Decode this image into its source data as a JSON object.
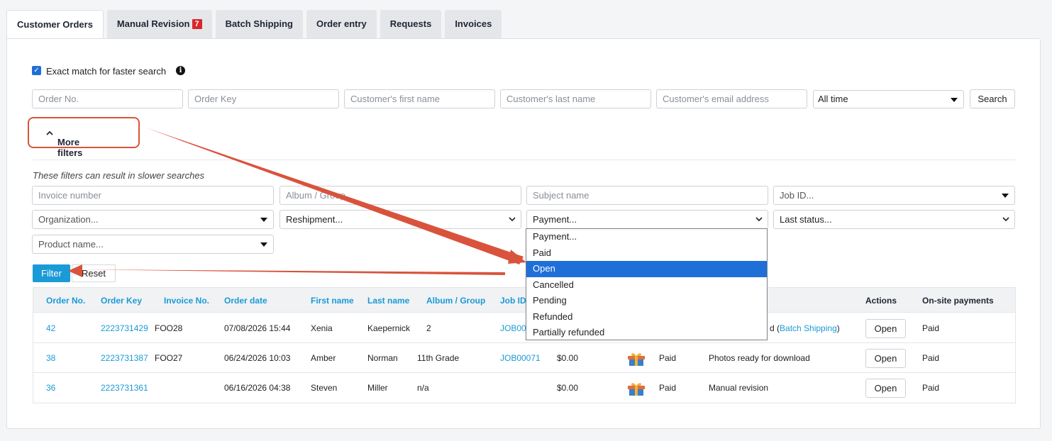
{
  "tabs": [
    {
      "label": "Customer Orders",
      "active": true
    },
    {
      "label": "Manual Revision",
      "badge": "7"
    },
    {
      "label": "Batch Shipping"
    },
    {
      "label": "Order entry"
    },
    {
      "label": "Requests"
    },
    {
      "label": "Invoices"
    }
  ],
  "search": {
    "exact_match_label": "Exact match for faster search",
    "exact_match_checked": true,
    "order_no_placeholder": "Order No.",
    "order_key_placeholder": "Order Key",
    "first_name_placeholder": "Customer's first name",
    "last_name_placeholder": "Customer's last name",
    "email_placeholder": "Customer's email address",
    "time_range_value": "All time",
    "search_label": "Search"
  },
  "more_filters": {
    "toggle_label": "More filters",
    "toggle_icon": "^",
    "note": "These filters can result in slower searches",
    "invoice_placeholder": "Invoice number",
    "album_placeholder": "Album / Group",
    "subject_placeholder": "Subject name",
    "job_placeholder": "Job ID...",
    "organization_placeholder": "Organization...",
    "reshipment_placeholder": "Reshipment...",
    "payment_placeholder": "Payment...",
    "last_status_placeholder": "Last status...",
    "product_placeholder": "Product name...",
    "filter_label": "Filter",
    "reset_label": "Reset"
  },
  "payment_dropdown": {
    "options": [
      "Payment...",
      "Paid",
      "Open",
      "Cancelled",
      "Pending",
      "Refunded",
      "Partially refunded"
    ],
    "highlighted": "Open"
  },
  "table": {
    "headers": {
      "order_no": "Order No.",
      "order_key": "Order Key",
      "invoice_no": "Invoice No.",
      "order_date": "Order date",
      "first_name": "First name",
      "last_name": "Last name",
      "album": "Album / Group",
      "job_id": "Job ID",
      "actions": "Actions",
      "onsite": "On-site payments"
    },
    "rows": [
      {
        "order_no": "42",
        "order_key": "2223731429",
        "invoice_no": "FOO28",
        "order_date": "07/08/2026 15:44",
        "first_name": "Xenia",
        "last_name": "Kaepernick",
        "album": "2",
        "job_id": "JOB00",
        "total": "",
        "payment": "",
        "status_prefix": "d (",
        "status_link": "Batch Shipping",
        "status_suffix": ")",
        "action": "Open",
        "onsite": "Paid"
      },
      {
        "order_no": "38",
        "order_key": "2223731387",
        "invoice_no": "FOO27",
        "order_date": "06/24/2026 10:03",
        "first_name": "Amber",
        "last_name": "Norman",
        "album": "11th Grade",
        "job_id": "JOB00071",
        "total": "$0.00",
        "payment": "Paid",
        "status": "Photos ready for download",
        "action": "Open",
        "onsite": "Paid"
      },
      {
        "order_no": "36",
        "order_key": "2223731361",
        "invoice_no": "",
        "order_date": "06/16/2026 04:38",
        "first_name": "Steven",
        "last_name": "Miller",
        "album": "n/a",
        "job_id": "",
        "total": "$0.00",
        "payment": "Paid",
        "status": "Manual revision",
        "action": "Open",
        "onsite": "Paid"
      }
    ]
  },
  "colors": {
    "accent": "#1a9ad6",
    "badge": "#d8262b",
    "annotation": "#d9533c",
    "highlight": "#1f6fd8"
  }
}
